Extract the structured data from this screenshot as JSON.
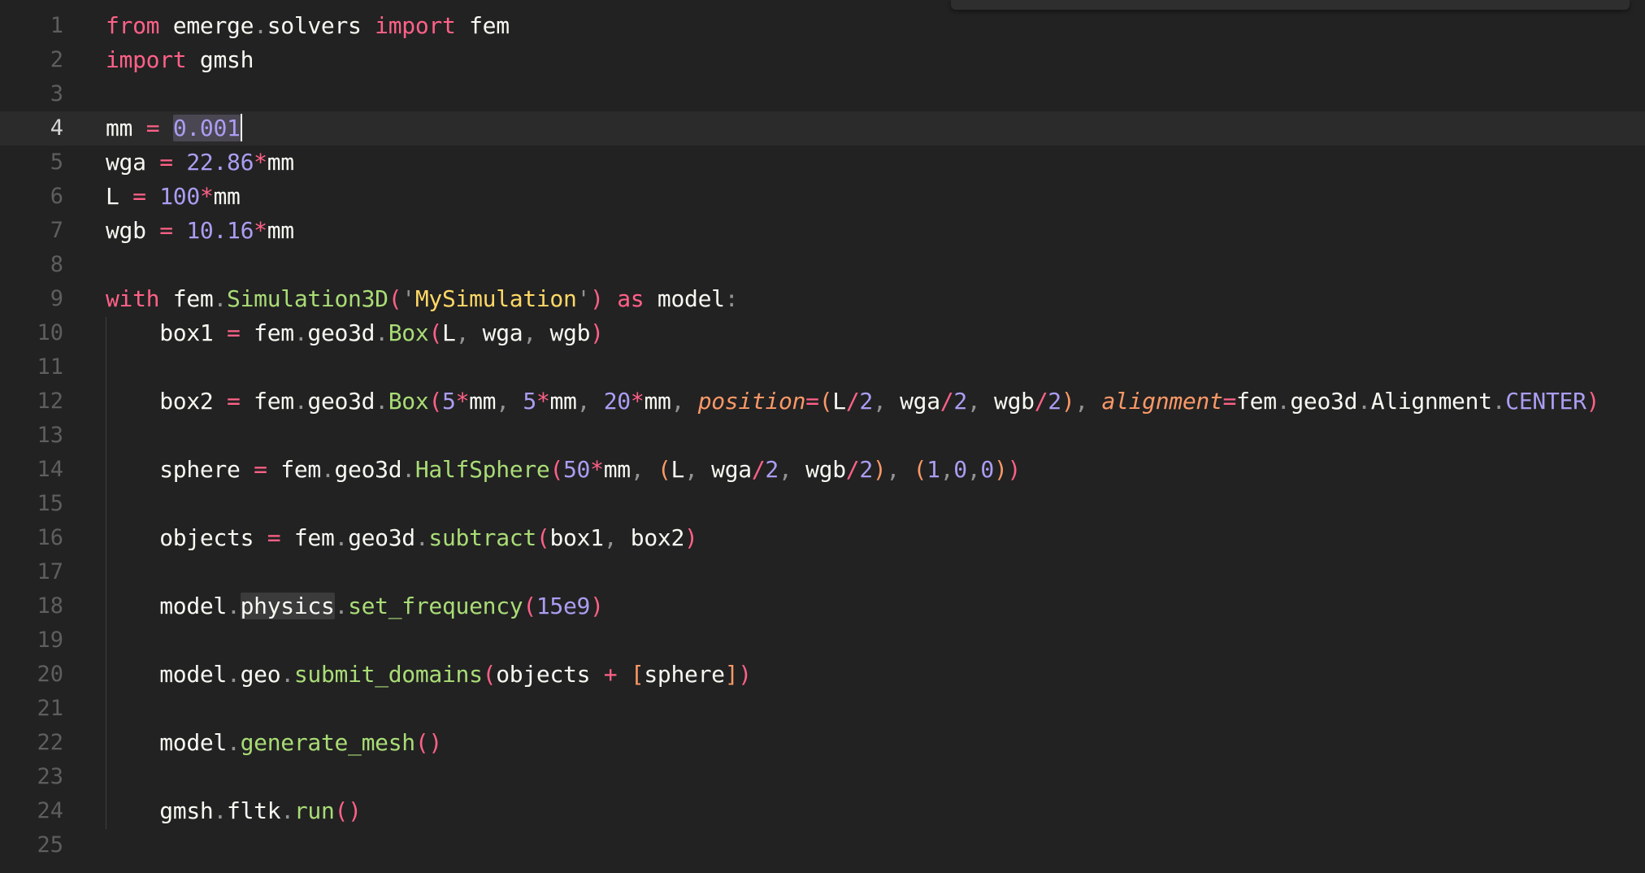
{
  "editor": {
    "lines": [
      {
        "num": "1",
        "tokens": [
          [
            "kw",
            "from"
          ],
          [
            "id",
            " emerge"
          ],
          [
            "pn",
            "."
          ],
          [
            "id",
            "solvers "
          ],
          [
            "kw",
            "import"
          ],
          [
            "id",
            " fem"
          ]
        ]
      },
      {
        "num": "2",
        "tokens": [
          [
            "kw",
            "import"
          ],
          [
            "id",
            " gmsh"
          ]
        ]
      },
      {
        "num": "3",
        "tokens": []
      },
      {
        "num": "4",
        "current": true,
        "tokens": [
          [
            "id",
            "mm "
          ],
          [
            "op",
            "="
          ],
          [
            "id",
            " "
          ],
          [
            "numsel",
            "0.001"
          ],
          [
            "cursor",
            ""
          ]
        ]
      },
      {
        "num": "5",
        "tokens": [
          [
            "id",
            "wga "
          ],
          [
            "op",
            "="
          ],
          [
            "id",
            " "
          ],
          [
            "num",
            "22.86"
          ],
          [
            "op",
            "*"
          ],
          [
            "id",
            "mm"
          ]
        ]
      },
      {
        "num": "6",
        "tokens": [
          [
            "id",
            "L "
          ],
          [
            "op",
            "="
          ],
          [
            "id",
            " "
          ],
          [
            "num",
            "100"
          ],
          [
            "op",
            "*"
          ],
          [
            "id",
            "mm"
          ]
        ]
      },
      {
        "num": "7",
        "tokens": [
          [
            "id",
            "wgb "
          ],
          [
            "op",
            "="
          ],
          [
            "id",
            " "
          ],
          [
            "num",
            "10.16"
          ],
          [
            "op",
            "*"
          ],
          [
            "id",
            "mm"
          ]
        ]
      },
      {
        "num": "8",
        "tokens": []
      },
      {
        "num": "9",
        "tokens": [
          [
            "kw",
            "with"
          ],
          [
            "id",
            " fem"
          ],
          [
            "pn",
            "."
          ],
          [
            "fn",
            "Simulation3D"
          ],
          [
            "paren",
            "("
          ],
          [
            "pn",
            "'"
          ],
          [
            "str",
            "MySimulation"
          ],
          [
            "pn",
            "'"
          ],
          [
            "paren",
            ")"
          ],
          [
            "id",
            " "
          ],
          [
            "kw",
            "as"
          ],
          [
            "id",
            " model"
          ],
          [
            "pn",
            ":"
          ]
        ]
      },
      {
        "num": "10",
        "tokens": [
          [
            "id",
            "    box1 "
          ],
          [
            "op",
            "="
          ],
          [
            "id",
            " fem"
          ],
          [
            "pn",
            "."
          ],
          [
            "id",
            "geo3d"
          ],
          [
            "pn",
            "."
          ],
          [
            "fn",
            "Box"
          ],
          [
            "paren",
            "("
          ],
          [
            "id",
            "L"
          ],
          [
            "pn",
            ","
          ],
          [
            "id",
            " wga"
          ],
          [
            "pn",
            ","
          ],
          [
            "id",
            " wgb"
          ],
          [
            "paren",
            ")"
          ]
        ]
      },
      {
        "num": "11",
        "tokens": []
      },
      {
        "num": "12",
        "tokens": [
          [
            "id",
            "    box2 "
          ],
          [
            "op",
            "="
          ],
          [
            "id",
            " fem"
          ],
          [
            "pn",
            "."
          ],
          [
            "id",
            "geo3d"
          ],
          [
            "pn",
            "."
          ],
          [
            "fn",
            "Box"
          ],
          [
            "paren",
            "("
          ],
          [
            "num",
            "5"
          ],
          [
            "op",
            "*"
          ],
          [
            "id",
            "mm"
          ],
          [
            "pn",
            ","
          ],
          [
            "id",
            " "
          ],
          [
            "num",
            "5"
          ],
          [
            "op",
            "*"
          ],
          [
            "id",
            "mm"
          ],
          [
            "pn",
            ","
          ],
          [
            "id",
            " "
          ],
          [
            "num",
            "20"
          ],
          [
            "op",
            "*"
          ],
          [
            "id",
            "mm"
          ],
          [
            "pn",
            ","
          ],
          [
            "id",
            " "
          ],
          [
            "arg",
            "position"
          ],
          [
            "op",
            "="
          ],
          [
            "paren2",
            "("
          ],
          [
            "id",
            "L"
          ],
          [
            "op",
            "/"
          ],
          [
            "num",
            "2"
          ],
          [
            "pn",
            ","
          ],
          [
            "id",
            " wga"
          ],
          [
            "op",
            "/"
          ],
          [
            "num",
            "2"
          ],
          [
            "pn",
            ","
          ],
          [
            "id",
            " wgb"
          ],
          [
            "op",
            "/"
          ],
          [
            "num",
            "2"
          ],
          [
            "paren2",
            ")"
          ],
          [
            "pn",
            ","
          ],
          [
            "id",
            " "
          ],
          [
            "arg",
            "alignment"
          ],
          [
            "op",
            "="
          ],
          [
            "id",
            "fem"
          ],
          [
            "pn",
            "."
          ],
          [
            "id",
            "geo3d"
          ],
          [
            "pn",
            "."
          ],
          [
            "id",
            "Alignment"
          ],
          [
            "pn",
            "."
          ],
          [
            "num",
            "CENTER"
          ],
          [
            "paren",
            ")"
          ]
        ]
      },
      {
        "num": "13",
        "tokens": []
      },
      {
        "num": "14",
        "tokens": [
          [
            "id",
            "    sphere "
          ],
          [
            "op",
            "="
          ],
          [
            "id",
            " fem"
          ],
          [
            "pn",
            "."
          ],
          [
            "id",
            "geo3d"
          ],
          [
            "pn",
            "."
          ],
          [
            "fn",
            "HalfSphere"
          ],
          [
            "paren",
            "("
          ],
          [
            "num",
            "50"
          ],
          [
            "op",
            "*"
          ],
          [
            "id",
            "mm"
          ],
          [
            "pn",
            ","
          ],
          [
            "id",
            " "
          ],
          [
            "paren2",
            "("
          ],
          [
            "id",
            "L"
          ],
          [
            "pn",
            ","
          ],
          [
            "id",
            " wga"
          ],
          [
            "op",
            "/"
          ],
          [
            "num",
            "2"
          ],
          [
            "pn",
            ","
          ],
          [
            "id",
            " wgb"
          ],
          [
            "op",
            "/"
          ],
          [
            "num",
            "2"
          ],
          [
            "paren2",
            ")"
          ],
          [
            "pn",
            ","
          ],
          [
            "id",
            " "
          ],
          [
            "paren2",
            "("
          ],
          [
            "num",
            "1"
          ],
          [
            "pn",
            ","
          ],
          [
            "num",
            "0"
          ],
          [
            "pn",
            ","
          ],
          [
            "num",
            "0"
          ],
          [
            "paren2",
            ")"
          ],
          [
            "paren",
            ")"
          ]
        ]
      },
      {
        "num": "15",
        "tokens": []
      },
      {
        "num": "16",
        "tokens": [
          [
            "id",
            "    objects "
          ],
          [
            "op",
            "="
          ],
          [
            "id",
            " fem"
          ],
          [
            "pn",
            "."
          ],
          [
            "id",
            "geo3d"
          ],
          [
            "pn",
            "."
          ],
          [
            "fn",
            "subtract"
          ],
          [
            "paren",
            "("
          ],
          [
            "id",
            "box1"
          ],
          [
            "pn",
            ","
          ],
          [
            "id",
            " box2"
          ],
          [
            "paren",
            ")"
          ]
        ]
      },
      {
        "num": "17",
        "tokens": []
      },
      {
        "num": "18",
        "tokens": [
          [
            "id",
            "    model"
          ],
          [
            "pn",
            "."
          ],
          [
            "hl",
            "physics"
          ],
          [
            "pn",
            "."
          ],
          [
            "fn",
            "set_frequency"
          ],
          [
            "paren",
            "("
          ],
          [
            "num",
            "15e9"
          ],
          [
            "paren",
            ")"
          ]
        ]
      },
      {
        "num": "19",
        "tokens": []
      },
      {
        "num": "20",
        "tokens": [
          [
            "id",
            "    model"
          ],
          [
            "pn",
            "."
          ],
          [
            "id",
            "geo"
          ],
          [
            "pn",
            "."
          ],
          [
            "fn",
            "submit_domains"
          ],
          [
            "paren",
            "("
          ],
          [
            "id",
            "objects "
          ],
          [
            "op",
            "+"
          ],
          [
            "id",
            " "
          ],
          [
            "paren2",
            "["
          ],
          [
            "id",
            "sphere"
          ],
          [
            "paren2",
            "]"
          ],
          [
            "paren",
            ")"
          ]
        ]
      },
      {
        "num": "21",
        "tokens": []
      },
      {
        "num": "22",
        "tokens": [
          [
            "id",
            "    model"
          ],
          [
            "pn",
            "."
          ],
          [
            "fn",
            "generate_mesh"
          ],
          [
            "paren",
            "()"
          ]
        ]
      },
      {
        "num": "23",
        "tokens": []
      },
      {
        "num": "24",
        "tokens": [
          [
            "id",
            "    gmsh"
          ],
          [
            "pn",
            "."
          ],
          [
            "id",
            "fltk"
          ],
          [
            "pn",
            "."
          ],
          [
            "fn",
            "run"
          ],
          [
            "paren",
            "()"
          ]
        ]
      },
      {
        "num": "25",
        "tokens": []
      }
    ]
  }
}
